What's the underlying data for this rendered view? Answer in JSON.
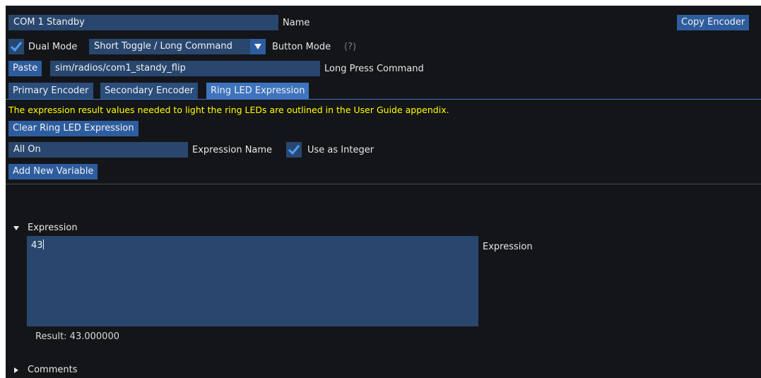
{
  "encoder": {
    "name_value": "COM 1 Standby",
    "name_label": "Name",
    "copy_button": "Copy Encoder"
  },
  "mode": {
    "dual_mode_label": "Dual Mode",
    "dual_mode_checked": true,
    "button_mode_selected": "Short Toggle / Long Command",
    "button_mode_label": "Button Mode",
    "help_marker": "(?)"
  },
  "long_press": {
    "paste_button": "Paste",
    "command_value": "sim/radios/com1_standy_flip",
    "command_label": "Long Press Command"
  },
  "tabs": [
    {
      "label": "Primary Encoder",
      "active": false
    },
    {
      "label": "Secondary Encoder",
      "active": false
    },
    {
      "label": "Ring LED Expression",
      "active": true
    }
  ],
  "ring_led": {
    "info_text": "The expression result values needed to light the ring LEDs are outlined in the User Guide appendix.",
    "clear_button": "Clear Ring LED Expression",
    "expression_name_value": "All On",
    "expression_name_label": "Expression Name",
    "use_as_integer_label": "Use as Integer",
    "use_as_integer_checked": true,
    "add_variable_button": "Add New Variable"
  },
  "expression_section": {
    "header": "Expression",
    "input_value": "43",
    "input_label": "Expression",
    "result_text": "Result: 43.000000"
  },
  "comments_section": {
    "header": "Comments"
  },
  "colors": {
    "background": "#141519",
    "frame": "#29476e",
    "button": "#2d5d9e",
    "tab_active": "#3e74bd",
    "check": "#4a9eff",
    "info_text": "#ffff00"
  }
}
